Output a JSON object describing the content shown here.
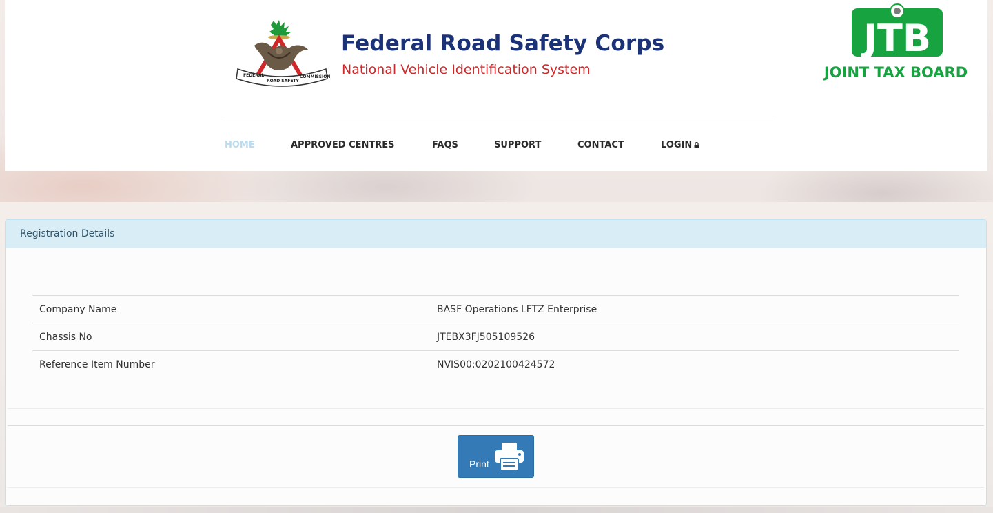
{
  "header": {
    "title": "Federal Road Safety Corps",
    "subtitle": "National Vehicle Identification System",
    "frsc_seal_text": "FEDERAL ROAD SAFETY COMMISSION",
    "jtb_logo_letters": "JTB",
    "jtb_logo_text": "JOINT TAX BOARD"
  },
  "nav": {
    "items": [
      {
        "label": "HOME",
        "active": true
      },
      {
        "label": "APPROVED CENTRES",
        "active": false
      },
      {
        "label": "FAQS",
        "active": false
      },
      {
        "label": "SUPPORT",
        "active": false
      },
      {
        "label": "CONTACT",
        "active": false
      },
      {
        "label": "LOGIN",
        "active": false,
        "icon": "lock-icon"
      }
    ]
  },
  "panel": {
    "heading": "Registration Details",
    "rows": [
      {
        "label": "Company Name",
        "value": "BASF Operations LFTZ Enterprise"
      },
      {
        "label": "Chassis No",
        "value": "JTEBX3FJ505109526"
      },
      {
        "label": "Reference Item Number",
        "value": "NVIS00:0202100424572"
      }
    ],
    "print_label": "Print",
    "print_icon": "printer-icon"
  },
  "colors": {
    "brand_blue": "#1c3276",
    "brand_red": "#d0282a",
    "jtb_green": "#17a340",
    "panel_heading_bg": "#d9edf7",
    "button_blue": "#337ab7",
    "nav_active": "#b9dbf0"
  }
}
